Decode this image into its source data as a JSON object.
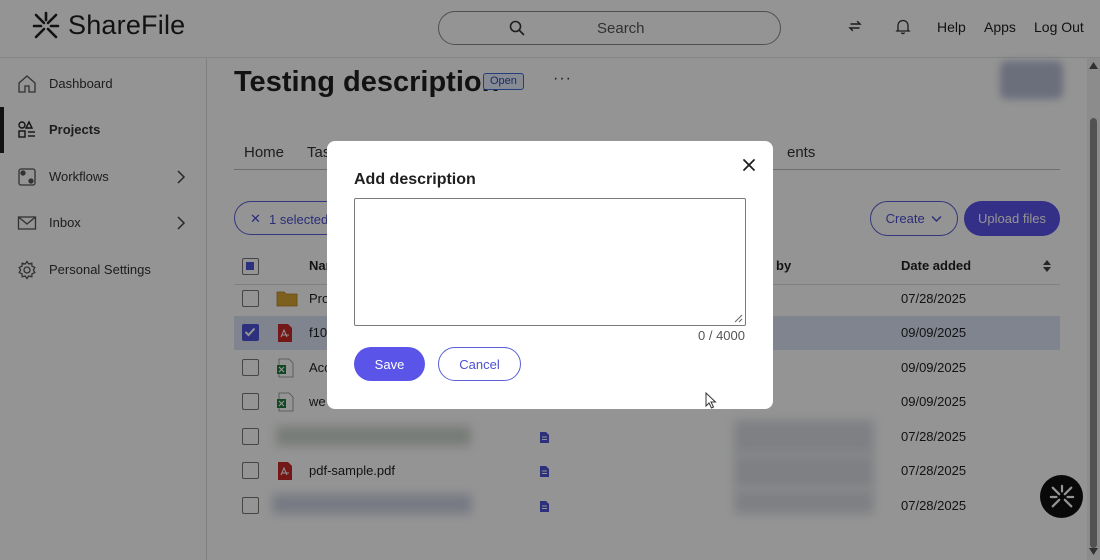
{
  "app": {
    "logo_text": "ShareFile",
    "search_placeholder": "Search",
    "nav_links": [
      "Help",
      "Apps",
      "Log Out"
    ]
  },
  "sidebar": {
    "items": [
      {
        "label": "Dashboard",
        "icon": "home-icon"
      },
      {
        "label": "Projects",
        "icon": "projects-icon",
        "active": true
      },
      {
        "label": "Workflows",
        "icon": "workflows-icon",
        "expandable": true
      },
      {
        "label": "Inbox",
        "icon": "inbox-icon",
        "expandable": true
      },
      {
        "label": "Personal Settings",
        "icon": "gear-icon"
      }
    ]
  },
  "project": {
    "title": "Testing description",
    "status": "Open",
    "more": "···"
  },
  "tabs": {
    "home": "Home",
    "tasks_partial": "Tas",
    "comments_partial": "ents"
  },
  "toolbar": {
    "selected_label": "1 selected",
    "create_label": "Create",
    "upload_label": "Upload files"
  },
  "table": {
    "headers": {
      "name_partial": "Nar",
      "by_partial": "by",
      "date_added": "Date added"
    },
    "rows": [
      {
        "name": "Pro",
        "type": "folder",
        "date": "07/28/2025",
        "selected": false
      },
      {
        "name": "f10",
        "type": "pdf",
        "date": "09/09/2025",
        "selected": true
      },
      {
        "name": "Acc",
        "type": "excel",
        "date": "09/09/2025",
        "selected": false
      },
      {
        "name": "we",
        "type": "excel",
        "date": "09/09/2025",
        "selected": false
      },
      {
        "name": "",
        "type": "blurred",
        "date": "07/28/2025",
        "selected": false
      },
      {
        "name": "pdf-sample.pdf",
        "type": "pdf",
        "date": "07/28/2025",
        "selected": false
      },
      {
        "name": "",
        "type": "blurred",
        "date": "07/28/2025",
        "selected": false
      }
    ]
  },
  "modal": {
    "title": "Add description",
    "textarea_value": "",
    "counter": "0 / 4000",
    "save_label": "Save",
    "cancel_label": "Cancel"
  },
  "colors": {
    "primary": "#5b54e8",
    "primary_outline": "#5b5fd6",
    "selected_row": "#dbe3f6",
    "badge_bg": "#e8f0ff"
  }
}
